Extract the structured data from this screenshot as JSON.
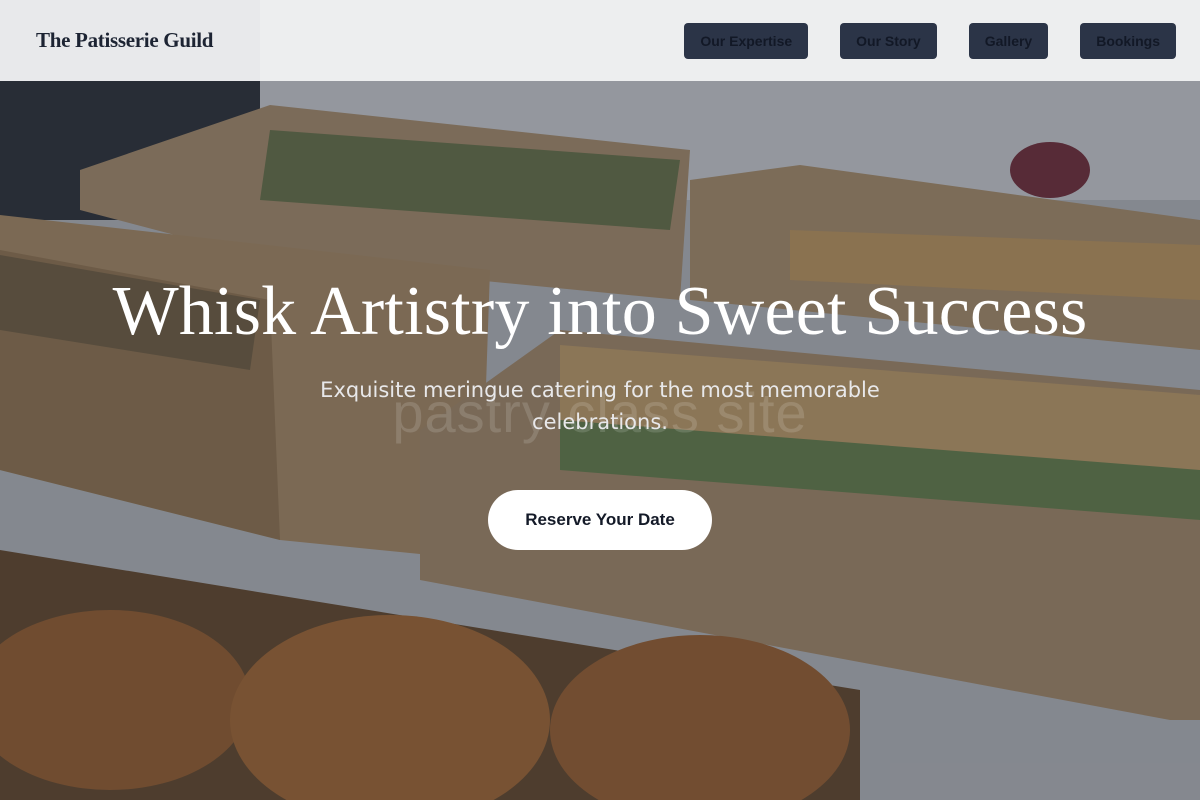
{
  "header": {
    "brand": "The Patisserie Guild",
    "nav": [
      {
        "label": "Our Expertise"
      },
      {
        "label": "Our Story"
      },
      {
        "label": "Gallery"
      },
      {
        "label": "Bookings"
      }
    ]
  },
  "hero": {
    "title": "Whisk Artistry into Sweet Success",
    "subtitle": "Exquisite meringue catering for the most memorable celebrations.",
    "watermark": "pastry class site",
    "cta_label": "Reserve Your Date"
  },
  "colors": {
    "nav_button_bg": "#2b3447",
    "nav_button_text": "#121826",
    "cta_bg": "#ffffff",
    "cta_text": "#141a28"
  }
}
